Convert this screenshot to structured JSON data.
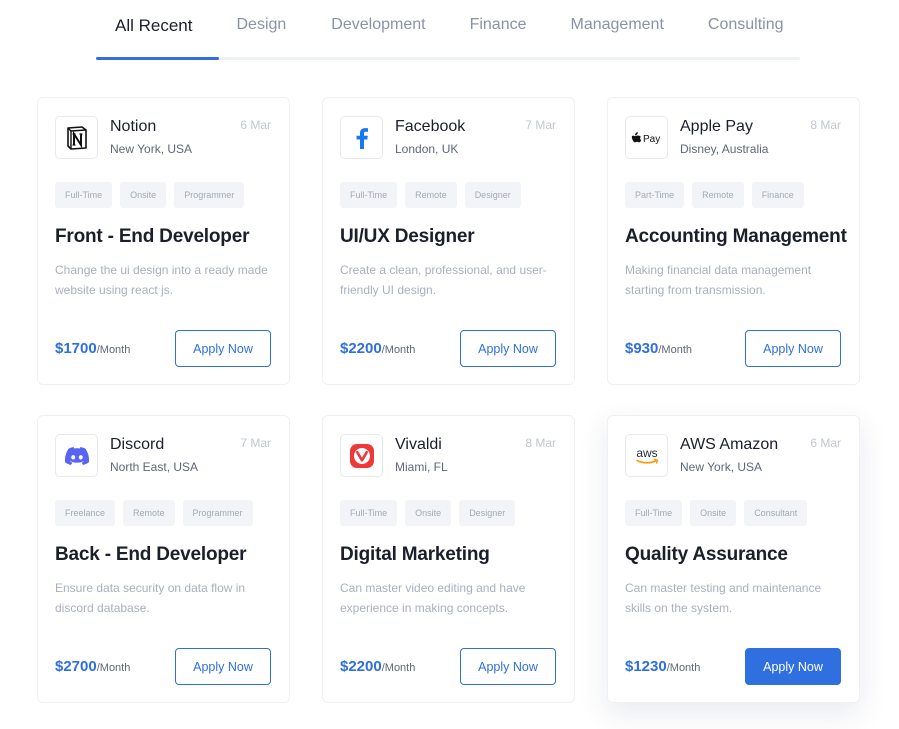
{
  "tabs": [
    {
      "label": "All Recent",
      "active": true
    },
    {
      "label": "Design"
    },
    {
      "label": "Development"
    },
    {
      "label": "Finance"
    },
    {
      "label": "Management"
    },
    {
      "label": "Consulting"
    }
  ],
  "colors": {
    "accent": "#2f6fe0",
    "discord": "#5865f2",
    "vivaldi": "#ef3939"
  },
  "jobs": [
    {
      "company": "Notion",
      "location": "New York, USA",
      "date": "6 Mar",
      "logo_icon": "notion-logo-icon",
      "tags": [
        "Full-Time",
        "Onsite",
        "Programmer"
      ],
      "title": "Front - End Developer",
      "description": "Change the ui design into a ready made website using react js.",
      "salary": "$1700",
      "salary_period": "/Month",
      "apply_label": "Apply Now"
    },
    {
      "company": "Facebook",
      "location": "London, UK",
      "date": "7 Mar",
      "logo_icon": "facebook-logo-icon",
      "tags": [
        "Full-Time",
        "Remote",
        "Designer"
      ],
      "title": "UI/UX Designer",
      "description": "Create a clean, professional, and user-friendly UI design.",
      "salary": "$2200",
      "salary_period": "/Month",
      "apply_label": "Apply Now"
    },
    {
      "company": "Apple Pay",
      "location": "Disney, Australia",
      "date": "8 Mar",
      "logo_icon": "apple-pay-logo-icon",
      "logo_text": "Pay",
      "tags": [
        "Part-Time",
        "Remote",
        "Finance"
      ],
      "title": "Accounting Management",
      "description": "Making financial data management starting from transmission.",
      "salary": "$930",
      "salary_period": "/Month",
      "apply_label": "Apply Now"
    },
    {
      "company": "Discord",
      "location": "North East, USA",
      "date": "7 Mar",
      "logo_icon": "discord-logo-icon",
      "tags": [
        "Freelance",
        "Remote",
        "Programmer"
      ],
      "title": "Back - End Developer",
      "description": "Ensure data security on data flow in discord database.",
      "salary": "$2700",
      "salary_period": "/Month",
      "apply_label": "Apply Now"
    },
    {
      "company": "Vivaldi",
      "location": "Miami, FL",
      "date": "8 Mar",
      "logo_icon": "vivaldi-logo-icon",
      "tags": [
        "Full-Time",
        "Onsite",
        "Designer"
      ],
      "title": "Digital Marketing",
      "description": "Can master video editing and have experience in making concepts.",
      "salary": "$2200",
      "salary_period": "/Month",
      "apply_label": "Apply Now"
    },
    {
      "company": "AWS Amazon",
      "location": "New York, USA",
      "date": "6 Mar",
      "logo_icon": "aws-logo-icon",
      "logo_text": "aws",
      "tags": [
        "Full-Time",
        "Onsite",
        "Consultant"
      ],
      "title": "Quality Assurance",
      "description": "Can master testing and maintenance skills on the system.",
      "salary": "$1230",
      "salary_period": "/Month",
      "apply_label": "Apply Now",
      "highlighted": true
    }
  ]
}
